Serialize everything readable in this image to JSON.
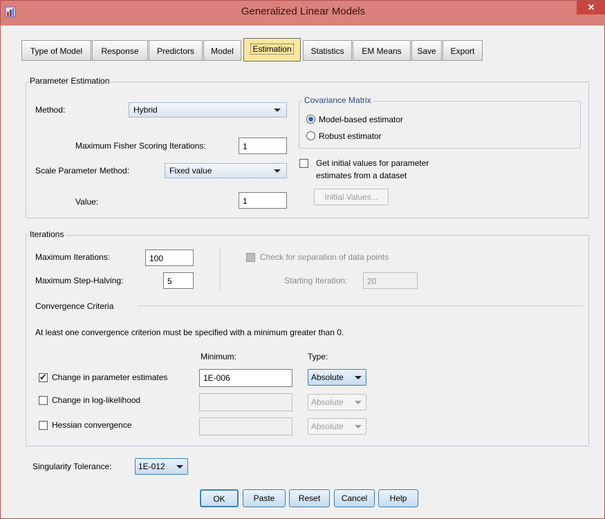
{
  "window": {
    "title": "Generalized Linear Models",
    "close_label": "✕"
  },
  "tabs": [
    {
      "label": "Type of Model"
    },
    {
      "label": "Response"
    },
    {
      "label": "Predictors"
    },
    {
      "label": "Model"
    },
    {
      "label": "Estimation"
    },
    {
      "label": "Statistics"
    },
    {
      "label": "EM Means"
    },
    {
      "label": "Save"
    },
    {
      "label": "Export"
    }
  ],
  "active_tab": "Estimation",
  "parameter_estimation": {
    "legend": "Parameter Estimation",
    "method_label": "Method:",
    "method_value": "Hybrid",
    "max_fisher_label": "Maximum Fisher Scoring Iterations:",
    "max_fisher_value": "1",
    "scale_method_label": "Scale Parameter Method:",
    "scale_method_value": "Fixed value",
    "value_label": "Value:",
    "value_value": "1",
    "covariance": {
      "legend": "Covariance Matrix",
      "model_based": "Model-based estimator",
      "robust": "Robust estimator",
      "selected": "Model-based estimator"
    },
    "initial_values_check_line1": "Get initial values for parameter",
    "initial_values_check_line2": "estimates from a dataset",
    "initial_values_button": "Initial Values..."
  },
  "iterations": {
    "legend": "Iterations",
    "max_iter_label": "Maximum Iterations:",
    "max_iter_value": "100",
    "max_step_label": "Maximum Step-Halving:",
    "max_step_value": "5",
    "check_separation_label": "Check for separation of data points",
    "starting_iter_label": "Starting Iteration:",
    "starting_iter_value": "20",
    "convergence_header": "Convergence Criteria",
    "convergence_note": "At least one convergence criterion must be specified with a minimum greater than 0.",
    "minimum_header": "Minimum:",
    "type_header": "Type:",
    "criteria": [
      {
        "label": "Change in parameter estimates",
        "checked": true,
        "minimum": "1E-006",
        "type": "Absolute"
      },
      {
        "label": "Change in log-likelihood",
        "checked": false,
        "minimum": "",
        "type": "Absolute"
      },
      {
        "label": "Hessian convergence",
        "checked": false,
        "minimum": "",
        "type": "Absolute"
      }
    ]
  },
  "singularity": {
    "label": "Singularity Tolerance:",
    "value": "1E-012"
  },
  "buttons": {
    "ok": "OK",
    "paste": "Paste",
    "reset": "Reset",
    "cancel": "Cancel",
    "help": "Help"
  },
  "colors": {
    "titlebar": "#d9817a",
    "active_tab": "#fbe7a0",
    "accent": "#2d62b6"
  }
}
